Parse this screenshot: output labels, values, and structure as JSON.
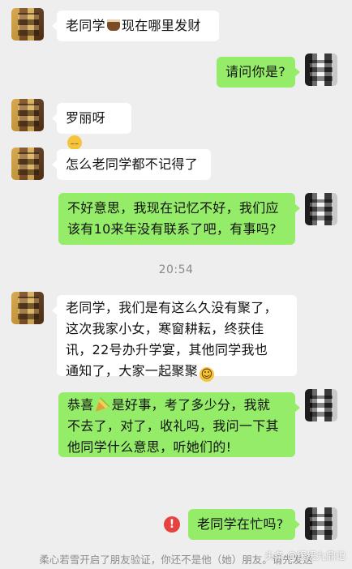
{
  "chat": {
    "messages": [
      {
        "id": "m1",
        "side": "in",
        "text_before": "老同学",
        "emoji": "coffee-emoji",
        "text_after": "现在哪里发财"
      },
      {
        "id": "m2",
        "side": "out",
        "text": "请问你是?"
      },
      {
        "id": "m3",
        "side": "in",
        "text_before": "罗丽呀",
        "emoji": "sweat-smile-emoji",
        "text_after": ""
      },
      {
        "id": "m4",
        "side": "in",
        "text": "怎么老同学都不记得了"
      },
      {
        "id": "m5",
        "side": "out",
        "lines": [
          "不好意思，我现在记忆不好，我们应",
          "该有10来年没有联系了吧，有事吗?"
        ]
      },
      {
        "id": "m6",
        "side": "in",
        "lines": [
          "老同学，我们是有这么久没有聚了，",
          "这次我家小女，寒窗耕耘，终获佳",
          "讯，22号办升学宴，其他同学我也",
          "通知了，大家一起聚聚"
        ],
        "emoji": "grin-emoji"
      },
      {
        "id": "m7",
        "side": "out",
        "lines_first_before": "恭喜",
        "lines_first_after": "是好事，考了多少分，我就",
        "lines": [
          "不去了，对了，收礼吗，我问一下其",
          "他同学什么意思，听她们的!"
        ],
        "emoji": "celebrate-emoji"
      },
      {
        "id": "m8",
        "side": "out",
        "text": "老同学在忙吗?",
        "status": "failed"
      }
    ],
    "timestamp": "20:54",
    "failed_icon": "!",
    "system_notice": "柔心若雪开启了朋友验证，你还不是他（她）朋友。请先发送",
    "watermark": "头条 @缓缓九鼎记"
  },
  "colors": {
    "background": "#eeeeee",
    "incoming_bubble": "#ffffff",
    "outgoing_bubble": "#95ec69",
    "error": "#e64340",
    "timestamp_text": "#8a8a8a"
  }
}
